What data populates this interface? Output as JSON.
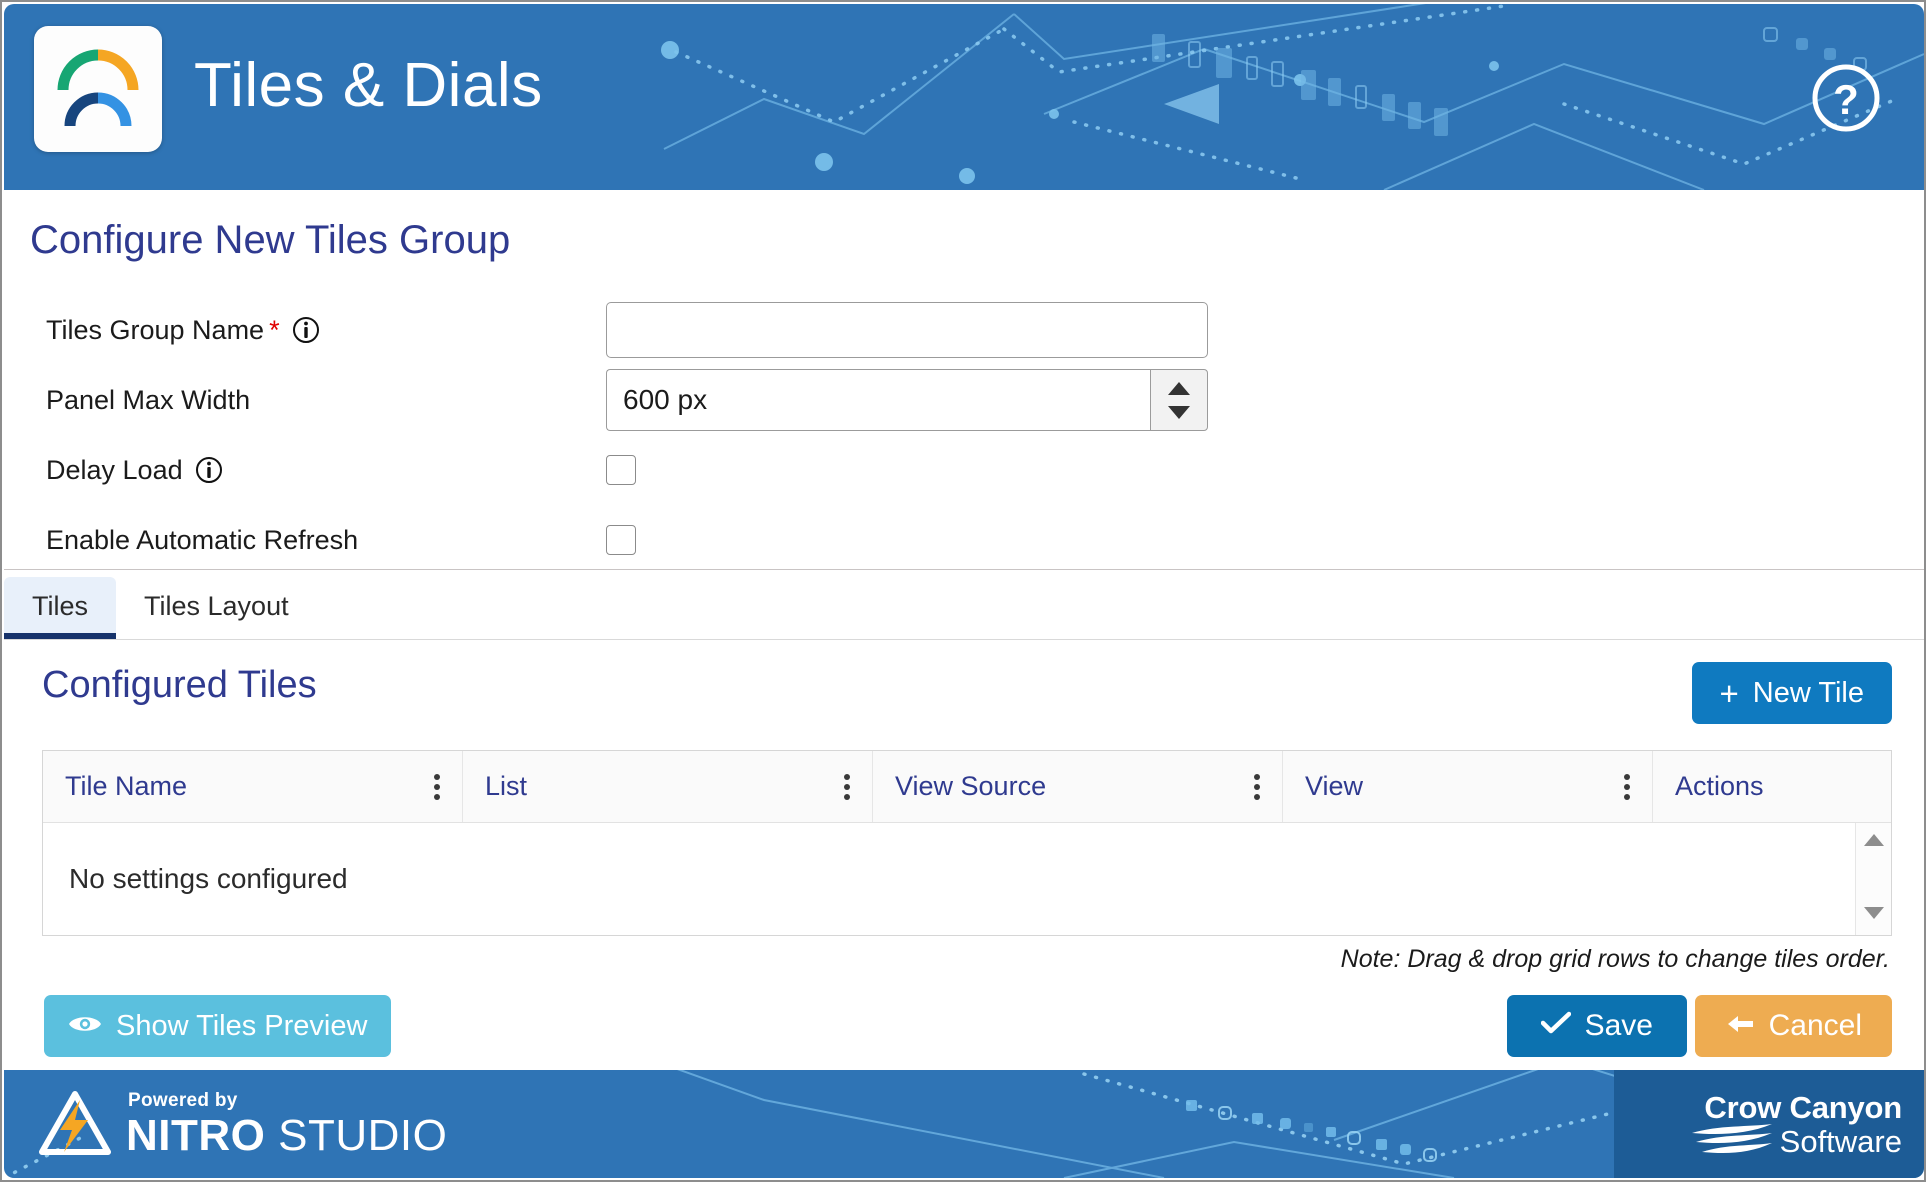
{
  "header": {
    "title": "Tiles & Dials",
    "logo_icon": "gauge-arcs-icon",
    "help_icon": "help-circle-icon",
    "bg_color": "#2f74b5"
  },
  "form": {
    "page_title": "Configure New Tiles Group",
    "fields": [
      {
        "label": "Tiles Group Name",
        "required_marker": "*",
        "has_info": true,
        "type": "text",
        "value": "",
        "placeholder": ""
      },
      {
        "label": "Panel Max Width",
        "required_marker": "",
        "has_info": false,
        "type": "spinner",
        "value": "600 px",
        "placeholder": ""
      },
      {
        "label": "Delay Load",
        "required_marker": "",
        "has_info": true,
        "type": "checkbox",
        "checked": false
      },
      {
        "label": "Enable Automatic Refresh",
        "required_marker": "",
        "has_info": false,
        "type": "checkbox",
        "checked": false
      }
    ]
  },
  "tabs": [
    {
      "label": "Tiles",
      "active": true
    },
    {
      "label": "Tiles Layout",
      "active": false
    }
  ],
  "main": {
    "section_title": "Configured Tiles",
    "new_tile_label": "New Tile",
    "new_tile_icon": "plus-icon",
    "grid": {
      "columns": [
        {
          "label": "Tile Name",
          "has_menu": true
        },
        {
          "label": "List",
          "has_menu": true
        },
        {
          "label": "View Source",
          "has_menu": true
        },
        {
          "label": "View",
          "has_menu": true
        },
        {
          "label": "Actions",
          "has_menu": false
        }
      ],
      "rows": [],
      "empty_message": "No settings configured",
      "scroll_up_icon": "triangle-up-icon",
      "scroll_down_icon": "triangle-down-icon"
    },
    "note": "Note: Drag & drop grid rows to change tiles order."
  },
  "actions": {
    "preview_label": "Show Tiles Preview",
    "preview_icon": "eye-icon",
    "preview_color": "#5bc0de",
    "save_label": "Save",
    "save_icon": "check-icon",
    "save_color": "#0c72b0",
    "cancel_label": "Cancel",
    "cancel_icon": "arrow-left-icon",
    "cancel_color": "#eeac51"
  },
  "footer": {
    "powered_by": "Powered by",
    "nitro_bold": "NITRO",
    "nitro_light": " STUDIO",
    "nitro_icon": "nitro-bolt-icon",
    "company_top": "Crow Canyon",
    "company_bottom": "Software",
    "company_icon": "crow-canyon-swoosh-icon"
  }
}
